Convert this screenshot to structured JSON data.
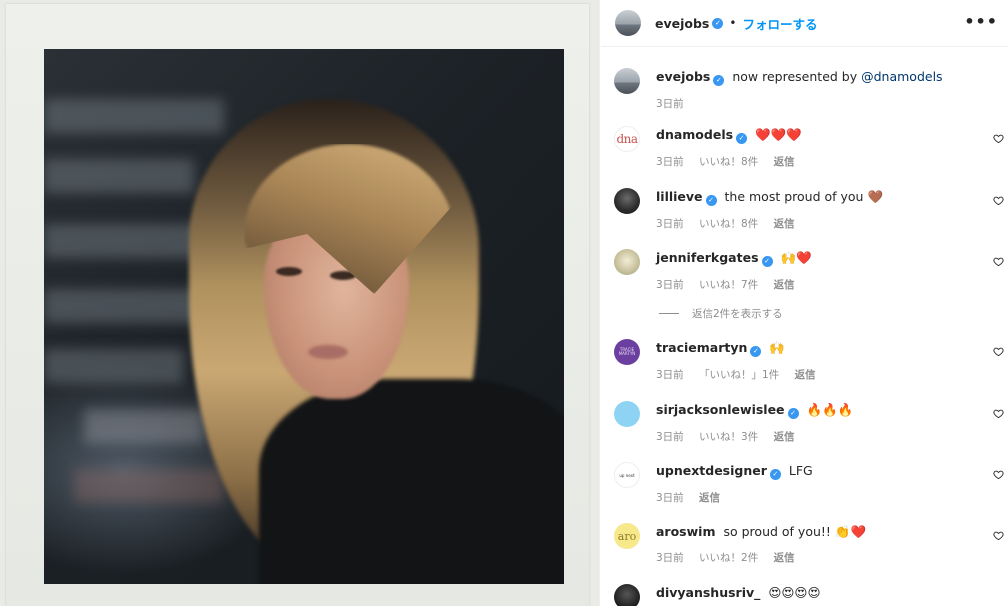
{
  "post": {
    "owner": "evejobs",
    "follow_label": "フォローする",
    "separator": "•",
    "more_label": "•••"
  },
  "caption": {
    "username": "evejobs",
    "text_prefix": "now represented by ",
    "mention": "@dnamodels",
    "time": "3日前"
  },
  "comments": [
    {
      "username": "dnamodels",
      "verified": true,
      "text": "❤️❤️❤️",
      "time": "3日前",
      "likes": "いいね！8件",
      "reply": "返信",
      "avatar": "dna"
    },
    {
      "username": "lillieve",
      "verified": true,
      "text": "the most proud of you 🤎",
      "time": "3日前",
      "likes": "いいね！8件",
      "reply": "返信"
    },
    {
      "username": "jenniferkgates",
      "verified": true,
      "text": "🙌❤️",
      "time": "3日前",
      "likes": "いいね！7件",
      "reply": "返信"
    },
    {
      "username": "traciemartyn",
      "verified": true,
      "text": "🙌",
      "time": "3日前",
      "likes": "「いいね！」1件",
      "reply": "返信",
      "avatar": "TRACIE MARTYN"
    },
    {
      "username": "sirjacksonlewislee",
      "verified": true,
      "text": "🔥🔥🔥",
      "time": "3日前",
      "likes": "いいね！3件",
      "reply": "返信"
    },
    {
      "username": "upnextdesigner",
      "verified": true,
      "text": "LFG",
      "time": "3日前",
      "likes": "",
      "reply": "返信",
      "avatar": "up next"
    },
    {
      "username": "aroswim",
      "verified": false,
      "text": "so proud of you!! 👏❤️",
      "time": "3日前",
      "likes": "いいね！2件",
      "reply": "返信",
      "avatar": "aro"
    },
    {
      "username": "divyanshusriv_",
      "verified": false,
      "text": "😍😍😍😍",
      "time": "",
      "likes": "",
      "reply": ""
    }
  ],
  "view_replies": "返信2件を表示する",
  "colors": {
    "accent": "#0095f6",
    "verified": "#3897f0",
    "muted": "#8e8e8e"
  }
}
